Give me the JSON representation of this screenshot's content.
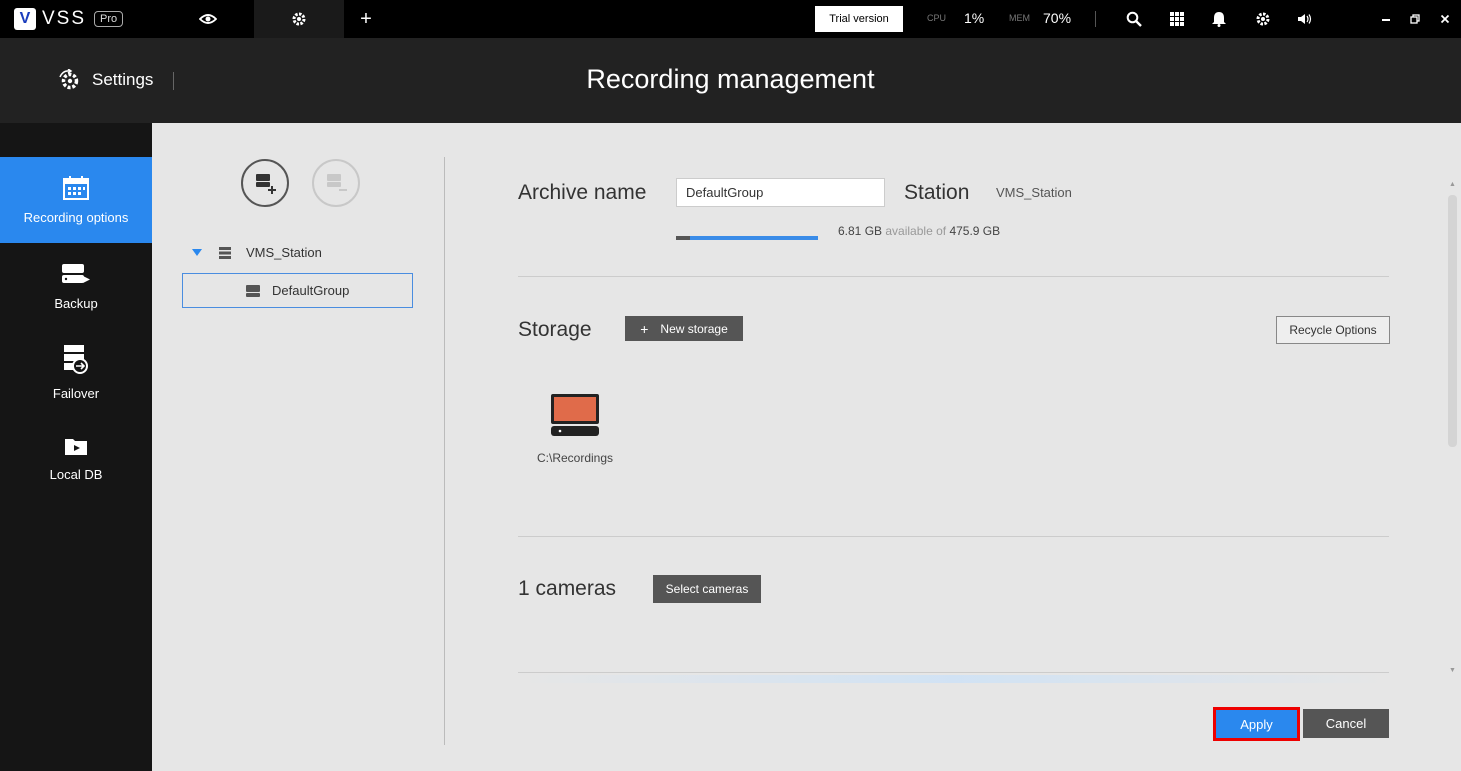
{
  "app": {
    "logo_letter": "V",
    "name": "VSS",
    "edition": "Pro"
  },
  "topbar": {
    "trial_label": "Trial version",
    "cpu_label": "CPU",
    "cpu_value": "1%",
    "mem_label": "MEM",
    "mem_value": "70%",
    "icons": [
      "eye-icon",
      "gear-icon",
      "plus-icon",
      "search-icon",
      "grid-icon",
      "bell-icon",
      "gear-icon",
      "volume-icon",
      "minimize-icon",
      "restore-icon",
      "close-icon"
    ]
  },
  "header": {
    "crumb": "Settings",
    "title": "Recording management"
  },
  "sidebar": {
    "items": [
      {
        "label": "Recording options",
        "icon": "calendar-icon",
        "active": true
      },
      {
        "label": "Backup",
        "icon": "backup-drive-icon"
      },
      {
        "label": "Failover",
        "icon": "failover-server-icon"
      },
      {
        "label": "Local DB",
        "icon": "folder-play-icon"
      }
    ]
  },
  "tree": {
    "station": "VMS_Station",
    "group": "DefaultGroup"
  },
  "archive": {
    "name_label": "Archive name",
    "name_value": "DefaultGroup",
    "station_label": "Station",
    "station_value": "VMS_Station",
    "available": "6.81 GB",
    "available_of": "available of",
    "total": "475.9 GB"
  },
  "storage": {
    "label": "Storage",
    "new_button": "New storage",
    "recycle_button": "Recycle Options",
    "items": [
      {
        "path": "C:\\Recordings"
      }
    ],
    "drive_color": "#e06b4a"
  },
  "cameras": {
    "label": "1 cameras",
    "select_button": "Select cameras"
  },
  "footer": {
    "apply": "Apply",
    "cancel": "Cancel"
  },
  "colors": {
    "accent": "#2a88ee",
    "highlight": "#e00000"
  }
}
